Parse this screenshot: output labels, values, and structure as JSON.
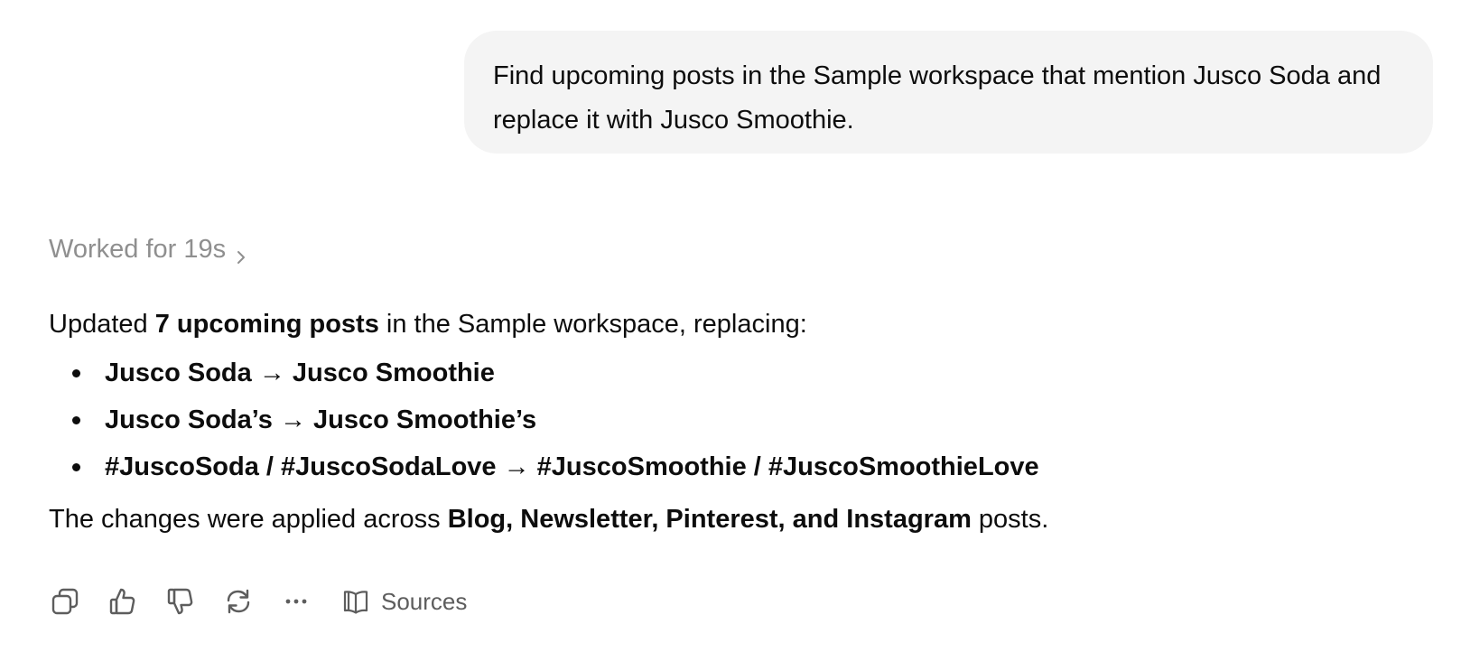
{
  "user_message": {
    "text": "Find upcoming posts in the Sample workspace that mention Jusco Soda and replace it with Jusco Smoothie."
  },
  "worked": {
    "label": "Worked for 19s",
    "icon": "chevron-right-icon"
  },
  "answer": {
    "intro": {
      "prefix": "Updated ",
      "bold": "7 upcoming posts",
      "suffix": " in the Sample workspace, replacing:"
    },
    "bullets": [
      {
        "text": "Jusco Soda → Jusco Smoothie"
      },
      {
        "text": "Jusco Soda’s → Jusco Smoothie’s"
      },
      {
        "text": "#JuscoSoda / #JuscoSodaLove → #JuscoSmoothie / #JuscoSmoothieLove"
      }
    ],
    "closing": {
      "prefix": "The changes were applied across ",
      "bold": "Blog, Newsletter, Pinterest, and Instagram",
      "suffix": " posts."
    }
  },
  "actions": {
    "icons": [
      "copy-icon",
      "thumbs-up-icon",
      "thumbs-down-icon",
      "regenerate-icon",
      "more-icon"
    ],
    "sources_label": "Sources",
    "sources_icon": "book-open-icon"
  },
  "colors": {
    "bubble_bg": "#f4f4f4",
    "text": "#0d0d0d",
    "muted": "#8f8f8f",
    "icon": "#5d5d5d"
  }
}
